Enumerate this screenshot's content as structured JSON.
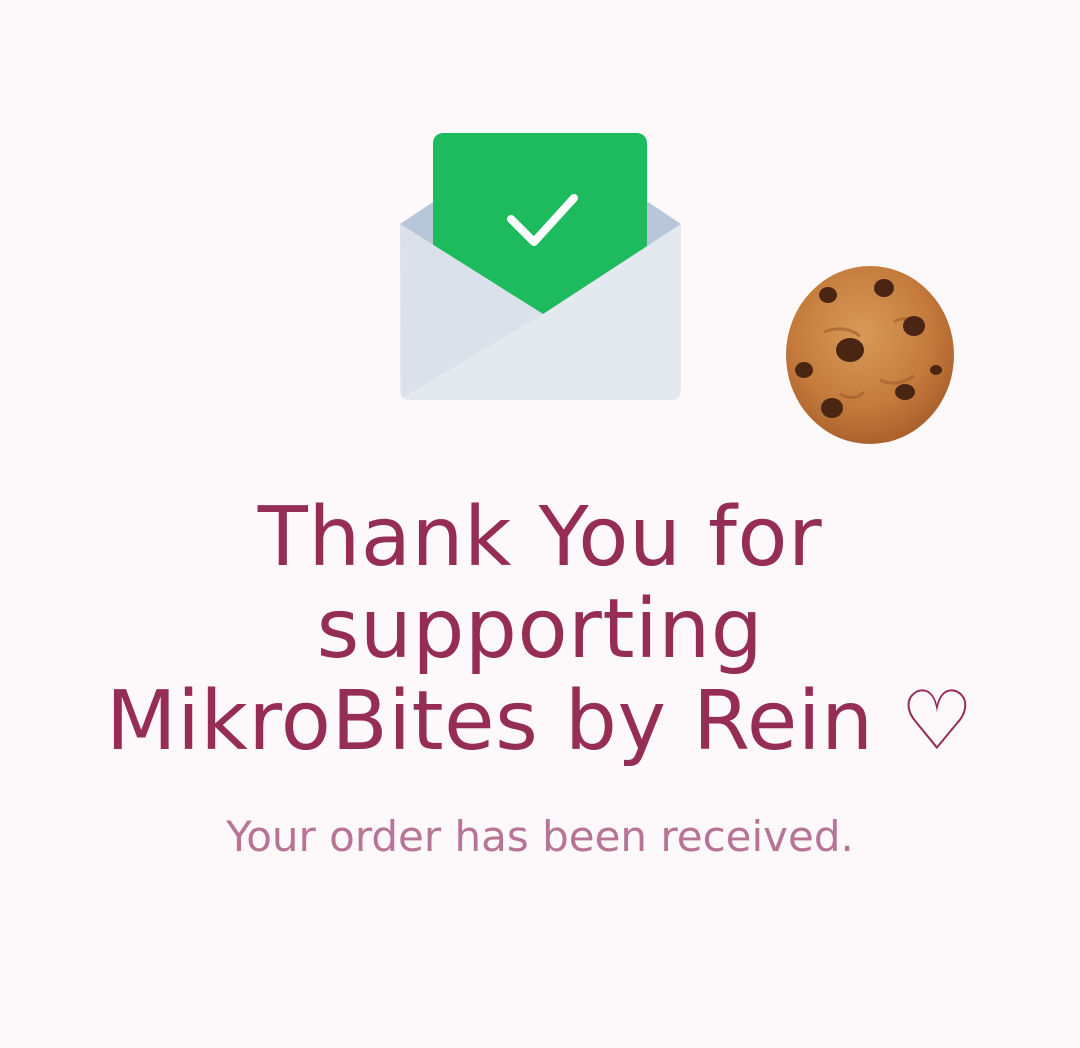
{
  "confirmation": {
    "icons": {
      "envelope": "envelope-check-icon",
      "cookie": "cookie-icon"
    },
    "headline_lines": [
      "Thank You for",
      "supporting",
      "MikroBites by Rein ♡"
    ],
    "message": "Your order has been received."
  },
  "colors": {
    "background": "#fdf8f9",
    "headline": "#952d55",
    "message": "#b87494",
    "check_card": "#1dbb5e",
    "envelope_back": "#b7c6d9",
    "envelope_front": "#e4e9f0"
  }
}
